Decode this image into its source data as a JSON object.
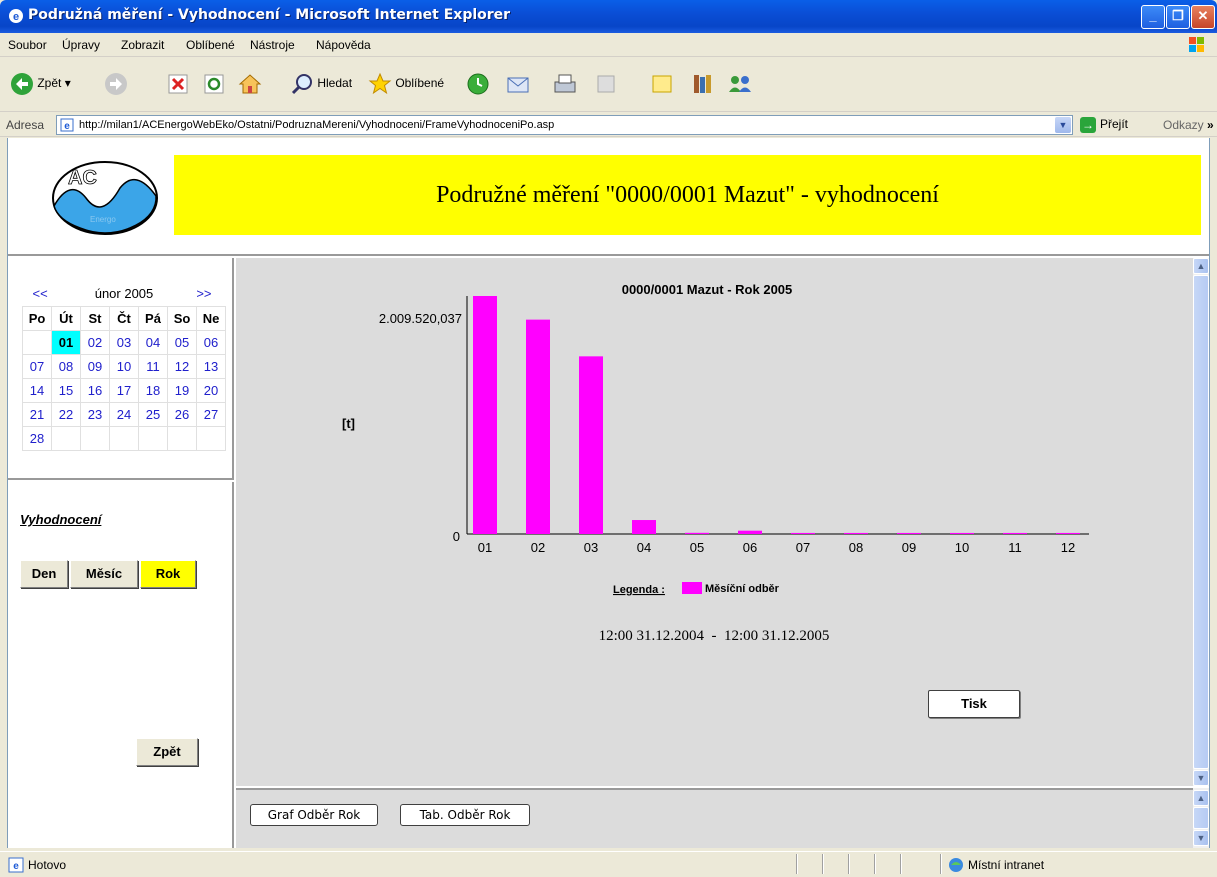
{
  "window": {
    "title": "Podružná měření - Vyhodnocení - Microsoft Internet Explorer"
  },
  "menu": [
    "Soubor",
    "Úpravy",
    "Zobrazit",
    "Oblíbené",
    "Nástroje",
    "Nápověda"
  ],
  "toolbar": {
    "back_label": "Zpět",
    "search_label": "Hledat",
    "favorites_label": "Oblíbené"
  },
  "address": {
    "label": "Adresa",
    "url": "http://milan1/ACEnergoWebEko/Ostatni/PodruznaMereni/Vyhodnoceni/FrameVyhodnoceniPo.asp",
    "go_label": "Přejít",
    "links_label": "Odkazy"
  },
  "header": {
    "logo_text": "AC",
    "logo_sub": "Energo",
    "banner_title": "Podružné měření \"0000/0001 Mazut\" - vyhodnocení",
    "banner_color": "#FFFF00"
  },
  "calendar": {
    "prev": "<<",
    "next": ">>",
    "month": "únor 2005",
    "weekdays": [
      "Po",
      "Út",
      "St",
      "Čt",
      "Pá",
      "So",
      "Ne"
    ],
    "weeks": [
      [
        "",
        "01",
        "02",
        "03",
        "04",
        "05",
        "06"
      ],
      [
        "07",
        "08",
        "09",
        "10",
        "11",
        "12",
        "13"
      ],
      [
        "14",
        "15",
        "16",
        "17",
        "18",
        "19",
        "20"
      ],
      [
        "21",
        "22",
        "23",
        "24",
        "25",
        "26",
        "27"
      ],
      [
        "28",
        "",
        "",
        "",
        "",
        "",
        ""
      ]
    ],
    "selected": "01",
    "selected_color": "#00FFFF"
  },
  "evaluation": {
    "title": "Vyhodnocení",
    "day_label": "Den",
    "month_label": "Měsíc",
    "year_label": "Rok",
    "active": "Rok",
    "back_label": "Zpět"
  },
  "chart_data": {
    "type": "bar",
    "title": "0000/0001 Mazut - Rok 2005",
    "ylabel": "[t]",
    "ytick_labels": [
      "0",
      "2.009.520,037"
    ],
    "ylim": [
      0,
      2009520037
    ],
    "categories": [
      "01",
      "02",
      "03",
      "04",
      "05",
      "06",
      "07",
      "08",
      "09",
      "10",
      "11",
      "12"
    ],
    "series": [
      {
        "name": "Měsíční odběr",
        "color": "#FF00FF",
        "values": [
          2009520037,
          1810000000,
          1500000000,
          118000000,
          10000000,
          28000000,
          9000000,
          9000000,
          9000000,
          9000000,
          9000000,
          9000000
        ]
      }
    ],
    "legend_title": "Legenda :",
    "period": "12:00 31.12.2004  -  12:00 31.12.2005",
    "grid": false
  },
  "chart_actions": {
    "print_label": "Tisk",
    "graph_label": "Graf Odběr Rok",
    "table_label": "Tab. Odběr Rok"
  },
  "status": {
    "text": "Hotovo",
    "zone": "Místní intranet"
  }
}
